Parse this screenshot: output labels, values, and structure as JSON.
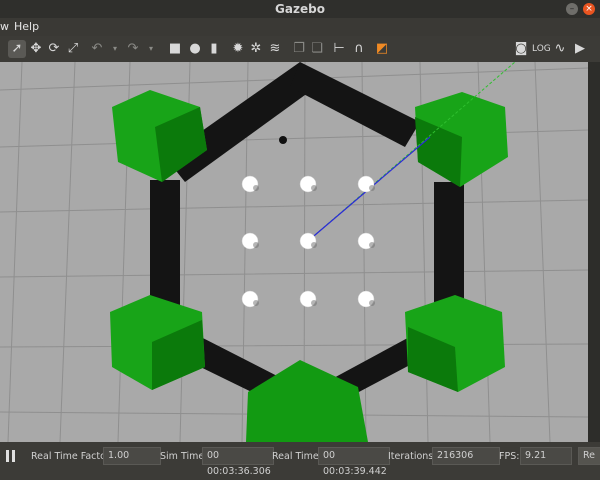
{
  "window": {
    "title": "Gazebo"
  },
  "menu": {
    "items": [
      "w",
      "Help"
    ]
  },
  "status": {
    "pause_icon": "pause-icon",
    "rtf_label": "Real Time Factor:",
    "rtf_value": "1.00",
    "sim_label": "Sim Time:",
    "sim_value": "00 00:03:36.306",
    "real_label": "Real Time:",
    "real_value": "00 00:03:39.442",
    "iter_label": "Iterations:",
    "iter_value": "216306",
    "fps_label": "FPS:",
    "fps_value": "9.21",
    "reset_label": "Re"
  },
  "colors": {
    "ground": "#a9a9a9",
    "wall": "#141414",
    "hex_green": "#1c9a1c",
    "axis_blue": "#2a2ad8",
    "axis_green": "#2fbf2f"
  }
}
